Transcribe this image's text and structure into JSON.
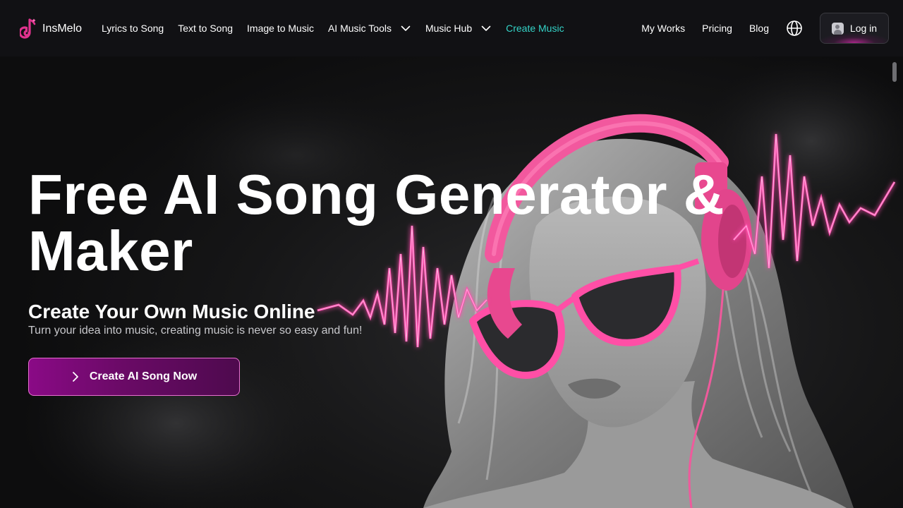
{
  "brand": {
    "name": "InsMelo",
    "icon": "music-note-logo-icon",
    "color": "#e0338e"
  },
  "nav": {
    "items": [
      {
        "label": "Lyrics to Song"
      },
      {
        "label": "Text to Song"
      },
      {
        "label": "Image to Music"
      },
      {
        "label": "AI Music Tools",
        "dropdown": true
      },
      {
        "label": "Music Hub",
        "dropdown": true
      },
      {
        "label": "Create Music",
        "active": true,
        "color": "#34d3c7"
      }
    ],
    "right": [
      {
        "label": "My Works"
      },
      {
        "label": "Pricing"
      },
      {
        "label": "Blog"
      }
    ],
    "language_icon": "globe-icon",
    "login_label": "Log in"
  },
  "hero": {
    "title": "Free AI Song Generator & Maker",
    "subtitle": "Create Your Own Music Online",
    "description": "Turn your idea into music, creating music is never so easy and fun!",
    "cta_label": "Create AI Song Now",
    "accent": "#ff4fb0",
    "cta_color": "#8a0a86"
  }
}
